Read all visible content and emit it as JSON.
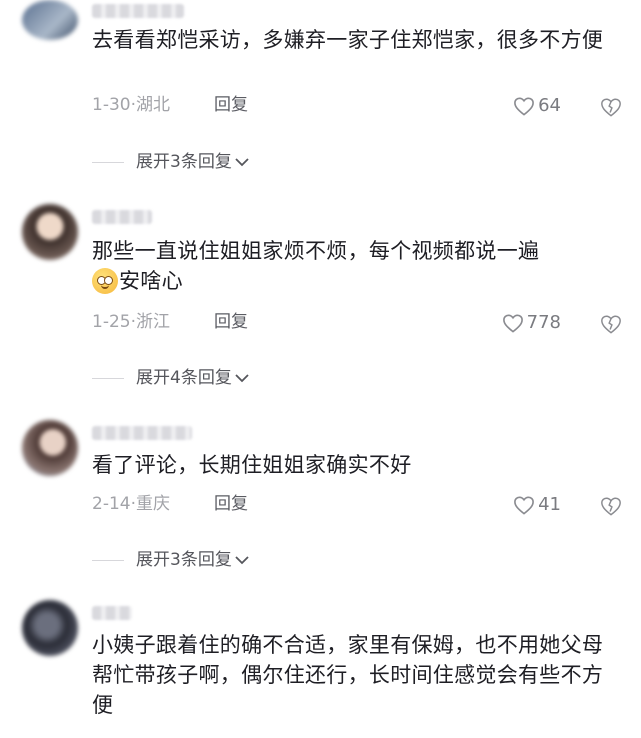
{
  "comments": [
    {
      "text": "去看看郑恺采访，多嫌弃一家子住郑恺家，很多不方便",
      "time": "1-30",
      "region": "湖北",
      "reply_label": "回复",
      "likes": "64",
      "expand_label": "展开3条回复"
    },
    {
      "text": "那些一直说住姐姐家烦不烦，每个视频都说一遍",
      "text_tail": "安啥心",
      "time": "1-25",
      "region": "浙江",
      "reply_label": "回复",
      "likes": "778",
      "expand_label": "展开4条回复"
    },
    {
      "text": "看了评论，长期住姐姐家确实不好",
      "time": "2-14",
      "region": "重庆",
      "reply_label": "回复",
      "likes": "41",
      "expand_label": "展开3条回复"
    },
    {
      "text": "小姨子跟着住的确不合适，家里有保姆，也不用她父母帮忙带孩子啊，偶尔住还行，长时间住感觉会有些不方便"
    }
  ],
  "meta_separator": "·",
  "colors": {
    "text": "#1e1e24",
    "meta": "#a2a3a8",
    "reply": "#5b5c63"
  },
  "icons": {
    "like": "heart-outline-icon",
    "dislike": "broken-heart-icon",
    "expand": "chevron-down-icon",
    "emoji": "smiling-face-emoji"
  }
}
